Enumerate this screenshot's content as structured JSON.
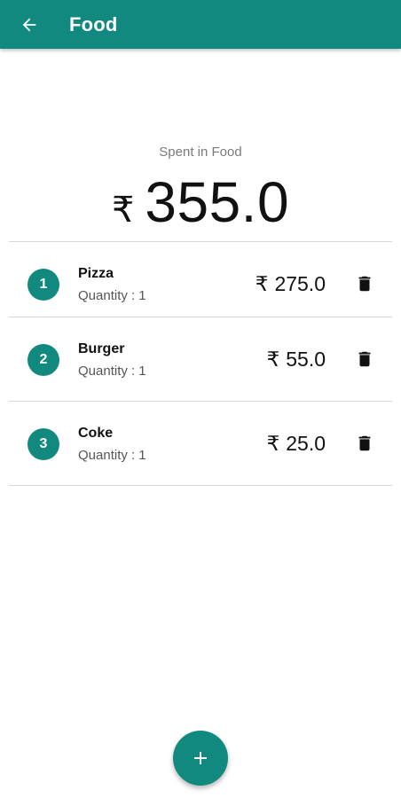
{
  "appbar": {
    "title": "Food",
    "back_icon": "arrow-back-icon",
    "color": "#12897f"
  },
  "summary": {
    "label": "Spent in Food",
    "currency": "₹",
    "amount": "355.0"
  },
  "items": [
    {
      "index": "1",
      "name": "Pizza",
      "quantity_label": "Quantity :",
      "quantity": "1",
      "currency": "₹",
      "price": "275.0",
      "delete_icon": "trash-icon"
    },
    {
      "index": "2",
      "name": "Burger",
      "quantity_label": "Quantity :",
      "quantity": "1",
      "currency": "₹",
      "price": "55.0",
      "delete_icon": "trash-icon"
    },
    {
      "index": "3",
      "name": "Coke",
      "quantity_label": "Quantity :",
      "quantity": "1",
      "currency": "₹",
      "price": "25.0",
      "delete_icon": "trash-icon"
    }
  ],
  "fab": {
    "icon": "plus-icon",
    "color": "#12897f"
  }
}
